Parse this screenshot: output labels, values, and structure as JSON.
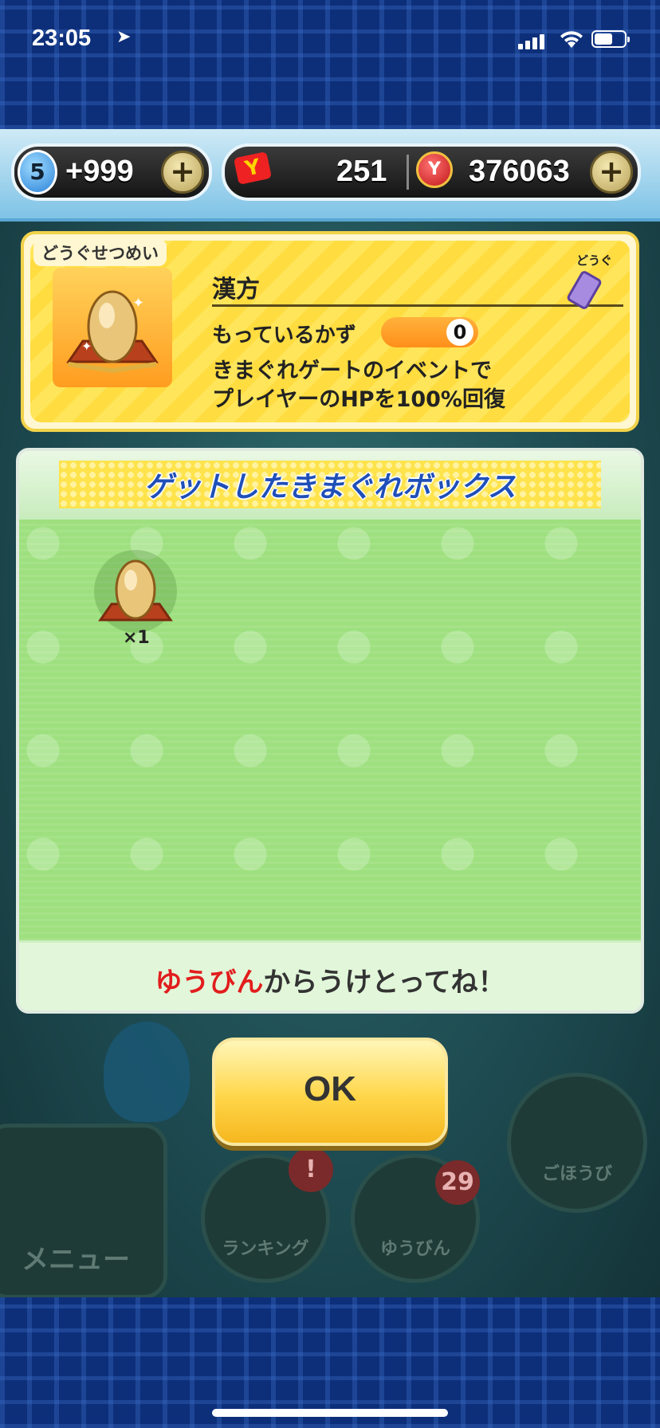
{
  "status_bar": {
    "time": "23:05",
    "location_icon": "location-arrow-icon"
  },
  "hud": {
    "stamina_level": "5",
    "stamina_value": "+999",
    "ticket_count": "251",
    "money_value": "376063",
    "plus_label": "+",
    "ticket_icon_label": "Y",
    "money_icon_label": "Y"
  },
  "item_card": {
    "tab_label": "どうぐせつめい",
    "item_name": "漢方",
    "category_label": "どうぐ",
    "count_label": "もっているかず",
    "count_value": "0",
    "description_line1": "きまぐれゲートのイベントで",
    "description_line2": "プレイヤーのHPを100%回復"
  },
  "gate_box": {
    "title": "ゲットしたきまぐれボックス",
    "items": [
      {
        "name": "漢方",
        "qty": "×1"
      }
    ],
    "footer_highlight": "ゆうびん",
    "footer_rest": "からうけとってね！"
  },
  "ok_button": {
    "label": "OK"
  },
  "background_menu": {
    "menu_label": "メニュー",
    "ranking_label": "ランキング",
    "ranking_badge": "!",
    "mail_label": "ゆうびん",
    "mail_badge": "29",
    "reward_label": "ごほうび"
  }
}
